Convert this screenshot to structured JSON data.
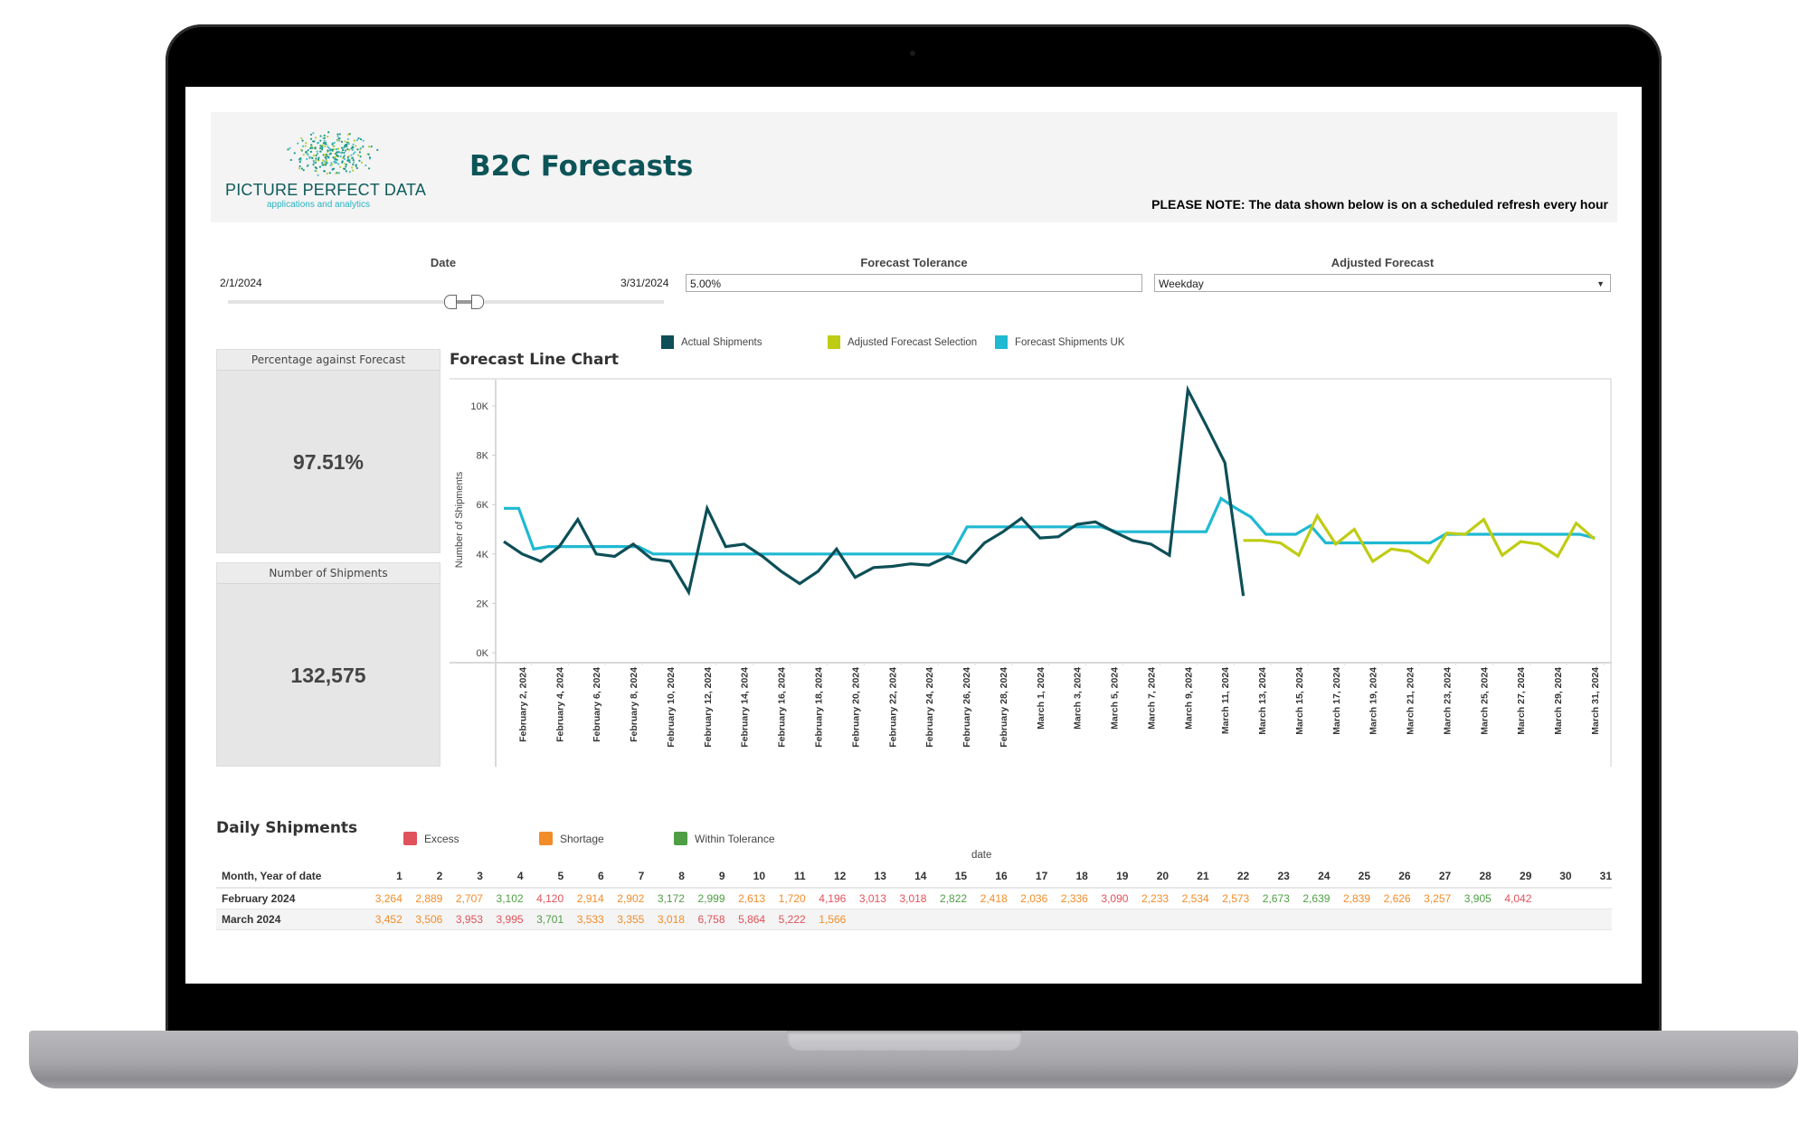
{
  "header": {
    "logo_name": "PICTURE PERFECT DATA",
    "logo_tagline": "applications and analytics",
    "title": "B2C Forecasts",
    "note": "PLEASE NOTE: The data shown below is on a scheduled refresh every hour"
  },
  "filters": {
    "date": {
      "label": "Date",
      "start": "2/1/2024",
      "end": "3/31/2024"
    },
    "tolerance": {
      "label": "Forecast Tolerance",
      "value": "5.00%"
    },
    "adjusted": {
      "label": "Adjusted Forecast",
      "value": "Weekday"
    }
  },
  "kpis": {
    "percentage": {
      "label": "Percentage against Forecast",
      "value": "97.51%"
    },
    "shipments": {
      "label": "Number of Shipments",
      "value": "132,575"
    }
  },
  "colors": {
    "actual": "#0d4f57",
    "adjusted": "#bfcc14",
    "forecast": "#1fb9d2",
    "excess": "#e0525a",
    "shortage": "#f28c28",
    "within": "#4e9e44"
  },
  "chart_data": {
    "type": "line",
    "title": "Forecast Line Chart",
    "xlabel": "",
    "ylabel": "Number of Shipments",
    "ylim": [
      0,
      11000
    ],
    "yticks": [
      "0K",
      "2K",
      "4K",
      "6K",
      "8K",
      "10K"
    ],
    "ytick_values": [
      0,
      2000,
      4000,
      6000,
      8000,
      10000
    ],
    "grid": false,
    "legend_position": "top",
    "x_start": "2024-02-01",
    "x_count": 60,
    "xtick_labels": [
      "February 2, 2024",
      "February 4, 2024",
      "February 6, 2024",
      "February 8, 2024",
      "February 10, 2024",
      "February 12, 2024",
      "February 14, 2024",
      "February 16, 2024",
      "February 18, 2024",
      "February 20, 2024",
      "February 22, 2024",
      "February 24, 2024",
      "February 26, 2024",
      "February 28, 2024",
      "March 1, 2024",
      "March 3, 2024",
      "March 5, 2024",
      "March 7, 2024",
      "March 9, 2024",
      "March 11, 2024",
      "March 13, 2024",
      "March 15, 2024",
      "March 17, 2024",
      "March 19, 2024",
      "March 21, 2024",
      "March 23, 2024",
      "March 25, 2024",
      "March 27, 2024",
      "March 29, 2024",
      "March 31, 2024"
    ],
    "xtick_index": [
      1,
      3,
      5,
      7,
      9,
      11,
      13,
      15,
      17,
      19,
      21,
      23,
      25,
      27,
      29,
      31,
      33,
      35,
      37,
      39,
      41,
      43,
      45,
      47,
      49,
      51,
      53,
      55,
      57,
      59
    ],
    "series": [
      {
        "name": "Actual Shipments",
        "color_key": "actual",
        "start_index": 0,
        "values": [
          4500,
          4000,
          3700,
          4300,
          5400,
          4000,
          3900,
          4400,
          3800,
          3700,
          2450,
          5850,
          4300,
          4400,
          3900,
          3300,
          2800,
          3300,
          4200,
          3050,
          3450,
          3500,
          3600,
          3550,
          3900,
          3650,
          4450,
          4900,
          5450,
          4650,
          4700,
          5200,
          5300,
          4900,
          4550,
          4400,
          3950,
          10650,
          9200,
          7700,
          2300
        ]
      },
      {
        "name": "Adjusted Forecast Selection",
        "color_key": "adjusted",
        "start_index": 40,
        "values": [
          4550,
          4550,
          4450,
          3950,
          5550,
          4400,
          5000,
          3700,
          4200,
          4100,
          3650,
          4850,
          4800,
          5400,
          3950,
          4500,
          4400,
          3900,
          5250,
          4600
        ]
      },
      {
        "name": "Forecast Shipments UK",
        "color_key": "forecast",
        "start_index": 0,
        "values": [
          5850,
          5850,
          4200,
          4300,
          4300,
          4300,
          4300,
          4300,
          4300,
          4300,
          4000,
          4000,
          4000,
          4000,
          4000,
          4000,
          4000,
          4000,
          4000,
          4000,
          4000,
          4000,
          4000,
          4000,
          4000,
          4000,
          4000,
          4000,
          4000,
          4000,
          4000,
          5100,
          5100,
          5100,
          5100,
          5100,
          5100,
          5100,
          5100,
          5100,
          5100,
          4900,
          4900,
          4900,
          4900,
          4900,
          4900,
          4900,
          6250,
          5850,
          5500,
          4800,
          4800,
          4800,
          5150,
          4450,
          4450,
          4450,
          4450,
          4450,
          4450,
          4450,
          4450,
          4800,
          4800,
          4800,
          4800,
          4800,
          4800,
          4800,
          4800,
          4800,
          4800,
          4650
        ]
      }
    ]
  },
  "daily": {
    "title": "Daily Shipments",
    "legend": [
      {
        "label": "Excess",
        "color_key": "excess"
      },
      {
        "label": "Shortage",
        "color_key": "shortage"
      },
      {
        "label": "Within Tolerance",
        "color_key": "within"
      }
    ],
    "column_caption": "date",
    "row_header": "Month, Year of date",
    "days": [
      "1",
      "2",
      "3",
      "4",
      "5",
      "6",
      "7",
      "8",
      "9",
      "10",
      "11",
      "12",
      "13",
      "14",
      "15",
      "16",
      "17",
      "18",
      "19",
      "20",
      "21",
      "22",
      "23",
      "24",
      "25",
      "26",
      "27",
      "28",
      "29",
      "30",
      "31"
    ],
    "rows": [
      {
        "month": "February 2024",
        "cells": [
          [
            "3,264",
            "shortage"
          ],
          [
            "2,889",
            "shortage"
          ],
          [
            "2,707",
            "shortage"
          ],
          [
            "3,102",
            "within"
          ],
          [
            "4,120",
            "excess"
          ],
          [
            "2,914",
            "shortage"
          ],
          [
            "2,902",
            "shortage"
          ],
          [
            "3,172",
            "within"
          ],
          [
            "2,999",
            "within"
          ],
          [
            "2,613",
            "shortage"
          ],
          [
            "1,720",
            "shortage"
          ],
          [
            "4,196",
            "excess"
          ],
          [
            "3,013",
            "excess"
          ],
          [
            "3,018",
            "excess"
          ],
          [
            "2,822",
            "within"
          ],
          [
            "2,418",
            "shortage"
          ],
          [
            "2,036",
            "shortage"
          ],
          [
            "2,336",
            "shortage"
          ],
          [
            "3,090",
            "excess"
          ],
          [
            "2,233",
            "shortage"
          ],
          [
            "2,534",
            "shortage"
          ],
          [
            "2,573",
            "shortage"
          ],
          [
            "2,673",
            "within"
          ],
          [
            "2,639",
            "within"
          ],
          [
            "2,839",
            "shortage"
          ],
          [
            "2,626",
            "shortage"
          ],
          [
            "3,257",
            "shortage"
          ],
          [
            "3,905",
            "within"
          ],
          [
            "4,042",
            "excess"
          ],
          [
            "",
            ""
          ],
          [
            "",
            ""
          ]
        ]
      },
      {
        "month": "March 2024",
        "cells": [
          [
            "3,452",
            "shortage"
          ],
          [
            "3,506",
            "shortage"
          ],
          [
            "3,953",
            "excess"
          ],
          [
            "3,995",
            "excess"
          ],
          [
            "3,701",
            "within"
          ],
          [
            "3,533",
            "shortage"
          ],
          [
            "3,355",
            "shortage"
          ],
          [
            "3,018",
            "shortage"
          ],
          [
            "6,758",
            "excess"
          ],
          [
            "5,864",
            "excess"
          ],
          [
            "5,222",
            "excess"
          ],
          [
            "1,566",
            "shortage"
          ],
          [
            "",
            ""
          ],
          [
            "",
            ""
          ],
          [
            "",
            ""
          ],
          [
            "",
            ""
          ],
          [
            "",
            ""
          ],
          [
            "",
            ""
          ],
          [
            "",
            ""
          ],
          [
            "",
            ""
          ],
          [
            "",
            ""
          ],
          [
            "",
            ""
          ],
          [
            "",
            ""
          ],
          [
            "",
            ""
          ],
          [
            "",
            ""
          ],
          [
            "",
            ""
          ],
          [
            "",
            ""
          ],
          [
            "",
            ""
          ],
          [
            "",
            ""
          ],
          [
            "",
            ""
          ],
          [
            "",
            ""
          ]
        ]
      }
    ]
  }
}
